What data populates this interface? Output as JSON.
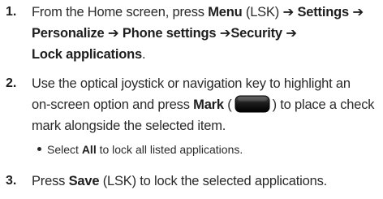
{
  "steps": [
    {
      "number": "1.",
      "lines": [
        [
          "From the Home screen, press ",
          {
            "b": "Menu"
          },
          " (LSK) ",
          {
            "b": "➔ Settings ➔"
          }
        ],
        [
          {
            "b": "Personalize ➔ Phone settings ➔Security ➔"
          }
        ],
        [
          {
            "b": "Lock applications"
          },
          "."
        ]
      ]
    },
    {
      "number": "2.",
      "lines": [
        [
          "Use the optical joystick or navigation key to highlight an"
        ],
        [
          "on-screen option and press ",
          {
            "b": "Mark"
          },
          " (",
          {
            "icon": "mark-key-icon"
          },
          ") to place a check"
        ],
        [
          "mark alongside the selected item."
        ]
      ]
    },
    {
      "bullet": [
        "Select ",
        {
          "b": "All"
        },
        " to lock all listed applications."
      ]
    },
    {
      "number": "3.",
      "lines": [
        [
          "Press ",
          {
            "b": "Save"
          },
          " (LSK) to lock the selected applications."
        ]
      ]
    }
  ]
}
